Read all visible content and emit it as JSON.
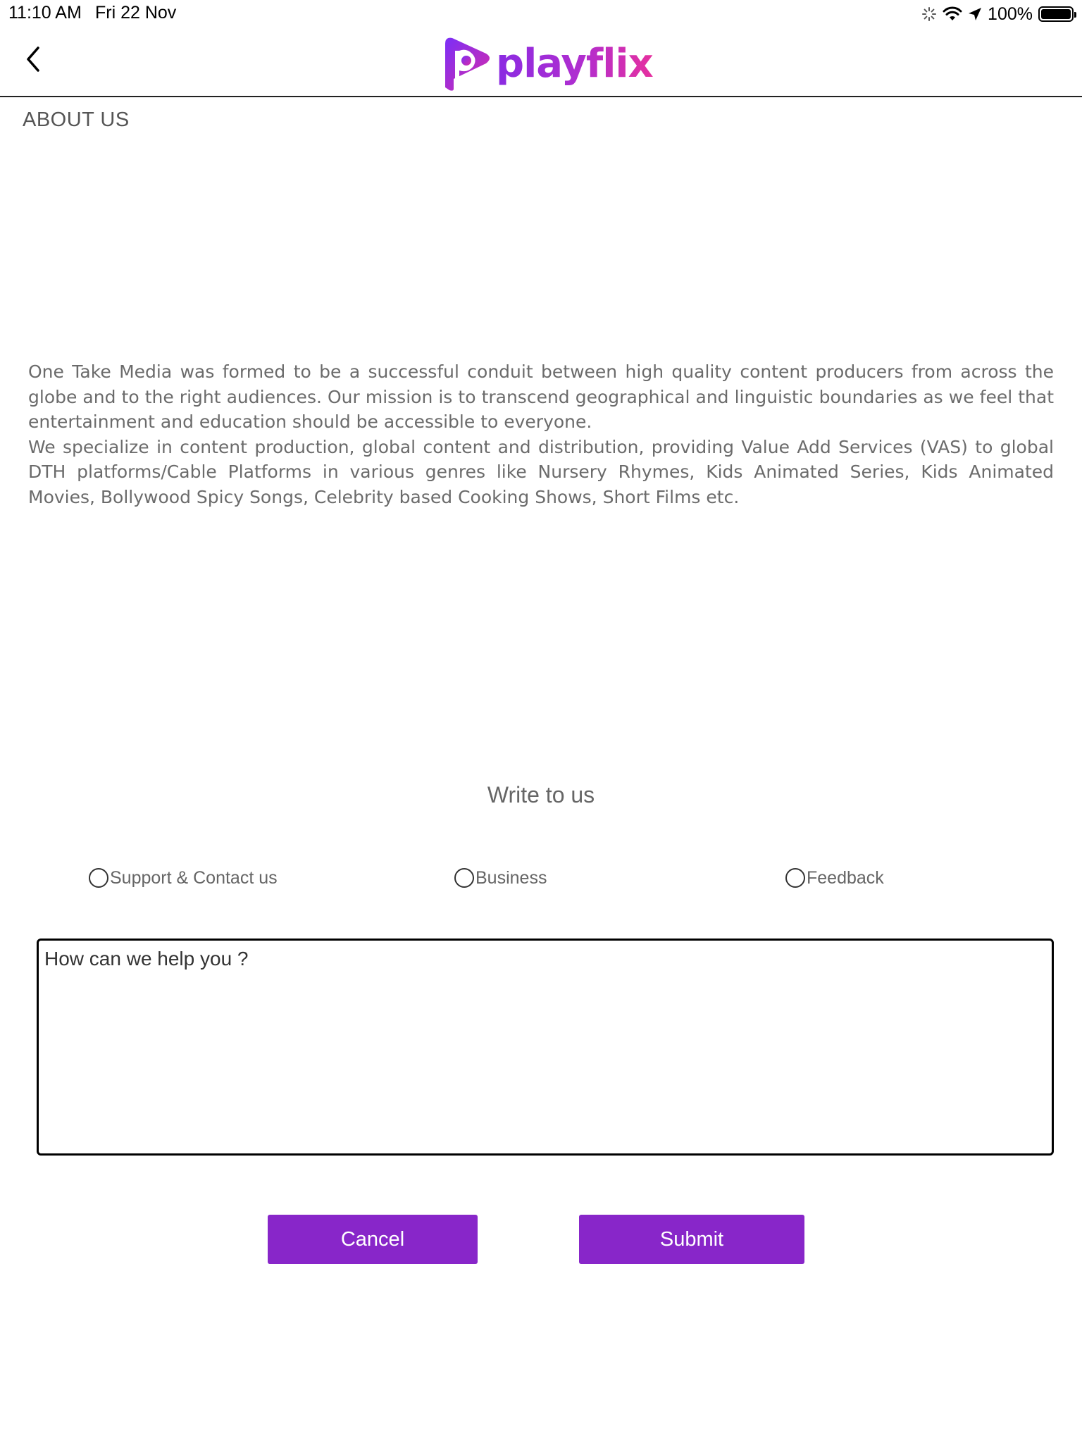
{
  "status_bar": {
    "time": "11:10 AM",
    "date": "Fri 22 Nov",
    "battery_percent": "100%"
  },
  "header": {
    "logo_text": "playflix",
    "brand_colors": {
      "gradient_start": "#8a2be2",
      "gradient_end": "#e6309f"
    }
  },
  "page": {
    "title": "ABOUT US"
  },
  "about": {
    "paragraph_1": "One Take Media was formed to be a successful conduit between high quality content producers from across the globe and to the right audiences. Our mission is to transcend geographical and linguistic boundaries as we feel that entertainment and education should be accessible to everyone.",
    "paragraph_2": "We specialize in content production, global content and distribution, providing Value Add Services (VAS) to global DTH platforms/Cable Platforms in various genres like Nursery Rhymes, Kids Animated Series, Kids Animated Movies, Bollywood Spicy Songs, Celebrity based Cooking Shows, Short Films etc."
  },
  "contact": {
    "heading": "Write to us",
    "options": [
      {
        "label": "Support & Contact us",
        "selected": false
      },
      {
        "label": "Business",
        "selected": false
      },
      {
        "label": "Feedback",
        "selected": false
      }
    ],
    "message_placeholder": "How can we help you ?",
    "message_value": "",
    "cancel_label": "Cancel",
    "submit_label": "Submit",
    "button_color": "#8826c9"
  }
}
